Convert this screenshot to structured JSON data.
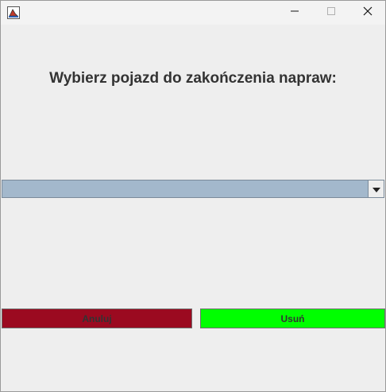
{
  "window": {
    "title": "",
    "controls": [
      "minimize-icon",
      "maximize-icon",
      "close-icon"
    ]
  },
  "main": {
    "heading": "Wybierz pojazd do zakończenia napraw:",
    "vehicle_select": {
      "value": "",
      "icon": "chevron-down-icon"
    }
  },
  "buttons": {
    "cancel_label": "Anuluj",
    "delete_label": "Usuń"
  },
  "colors": {
    "cancel_bg": "#9b0a20",
    "delete_bg": "#00ff00",
    "combo_bg": "#a3b8cc"
  }
}
